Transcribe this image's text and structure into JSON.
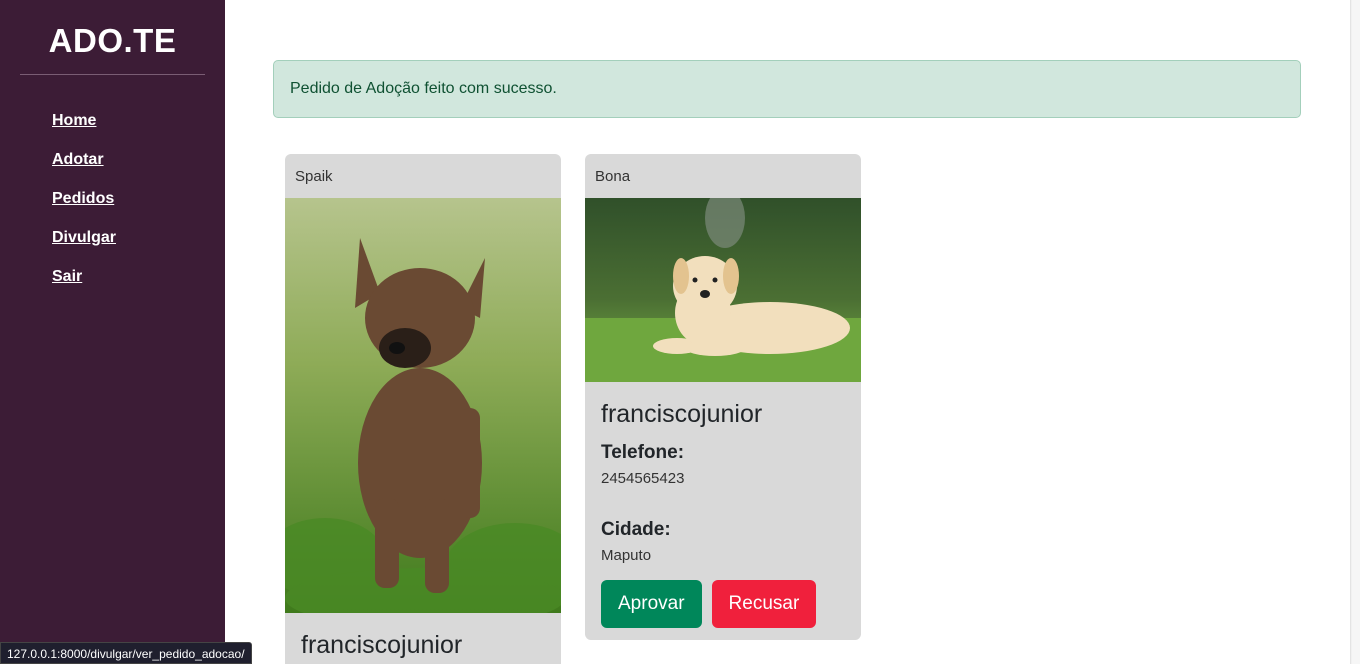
{
  "sidebar": {
    "brand": "ADO.TE",
    "items": [
      {
        "label": "Home"
      },
      {
        "label": "Adotar"
      },
      {
        "label": "Pedidos"
      },
      {
        "label": "Divulgar"
      },
      {
        "label": "Sair"
      }
    ]
  },
  "alert": {
    "message": "Pedido de Adoção feito com sucesso."
  },
  "cards": [
    {
      "pet_name": "Spaik",
      "username": "franciscojunior"
    },
    {
      "pet_name": "Bona",
      "username": "franciscojunior",
      "phone_label": "Telefone:",
      "phone": "2454565423",
      "city_label": "Cidade:",
      "city": "Maputo",
      "approve_label": "Aprovar",
      "reject_label": "Recusar"
    }
  ],
  "status_bar": {
    "url": "127.0.0.1:8000/divulgar/ver_pedido_adocao/"
  },
  "colors": {
    "sidebar_bg": "#3c1c36",
    "alert_bg": "#d1e7dd",
    "alert_text": "#0f5132",
    "card_bg": "#d9d9d9",
    "approve": "#00875a",
    "reject": "#f0203c"
  }
}
